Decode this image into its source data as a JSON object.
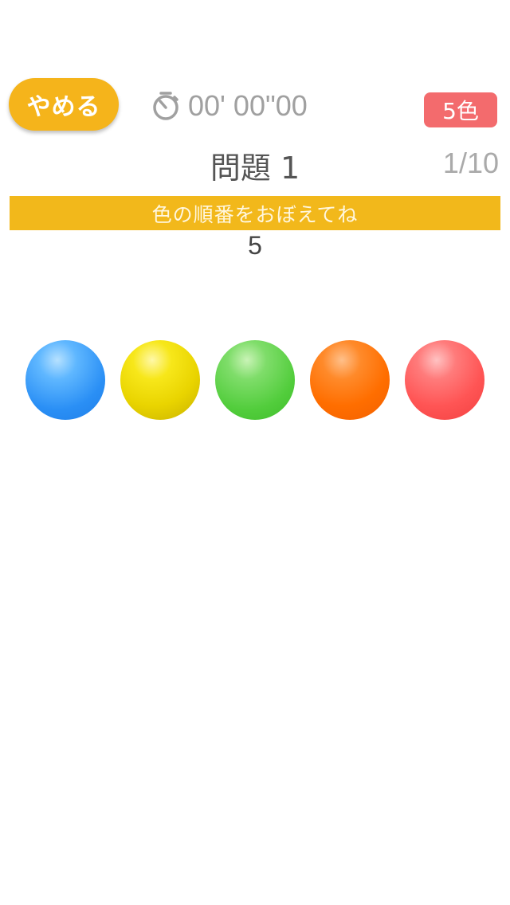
{
  "header": {
    "quit_label": "やめる",
    "timer_text": "00' 00\"00",
    "color_count_label": "5色"
  },
  "question": {
    "title": "問題 1",
    "progress": "1/10"
  },
  "instruction": "色の順番をおぼえてね",
  "countdown": "5",
  "balls": [
    {
      "color": "blue",
      "hex": "#2a8ff5"
    },
    {
      "color": "yellow",
      "hex": "#e9d400"
    },
    {
      "color": "green",
      "hex": "#52cd3c"
    },
    {
      "color": "orange",
      "hex": "#ff6e00"
    },
    {
      "color": "red",
      "hex": "#ff5555"
    }
  ],
  "colors": {
    "accent": "#f5b41b",
    "badge": "#f36b6d",
    "timer_text": "#a0a0a0"
  }
}
